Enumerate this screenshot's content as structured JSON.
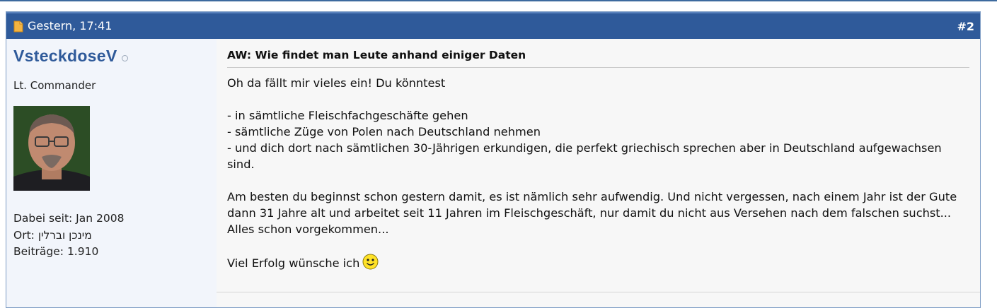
{
  "post": {
    "date": "Gestern, 17:41",
    "number": "#2"
  },
  "user": {
    "name": "VsteckdoseV",
    "rank": "Lt. Commander",
    "joined": "Dabei seit: Jan 2008",
    "location": "Ort: מינכן וברלין",
    "posts": "Beiträge: 1.910"
  },
  "content": {
    "title": "AW: Wie findet man Leute anhand einiger Daten",
    "line1": "Oh da fällt mir vieles ein! Du könntest",
    "list": [
      "- in sämtliche Fleischfachgeschäfte gehen",
      "- sämtliche Züge von Polen nach Deutschland nehmen",
      "- und dich dort nach sämtlichen 30-Jährigen erkundigen, die perfekt griechisch sprechen aber in Deutschland aufgewachsen sind."
    ],
    "paragraph": "Am besten du beginnst schon gestern damit, es ist nämlich sehr aufwendig. Und nicht vergessen, nach einem Jahr ist der Gute dann 31 Jahre alt und arbeitet seit 11 Jahren im Fleischgeschäft, nur damit du nicht aus Versehen nach dem falschen suchst... Alles schon vorgekommen...",
    "closing": "Viel Erfolg wünsche ich"
  },
  "icons": {
    "doc": "document-icon",
    "status": "offline-status-icon",
    "smiley": "smiley-icon"
  },
  "colors": {
    "header_bg": "#2f5a9a",
    "username": "#2f5a9a"
  }
}
